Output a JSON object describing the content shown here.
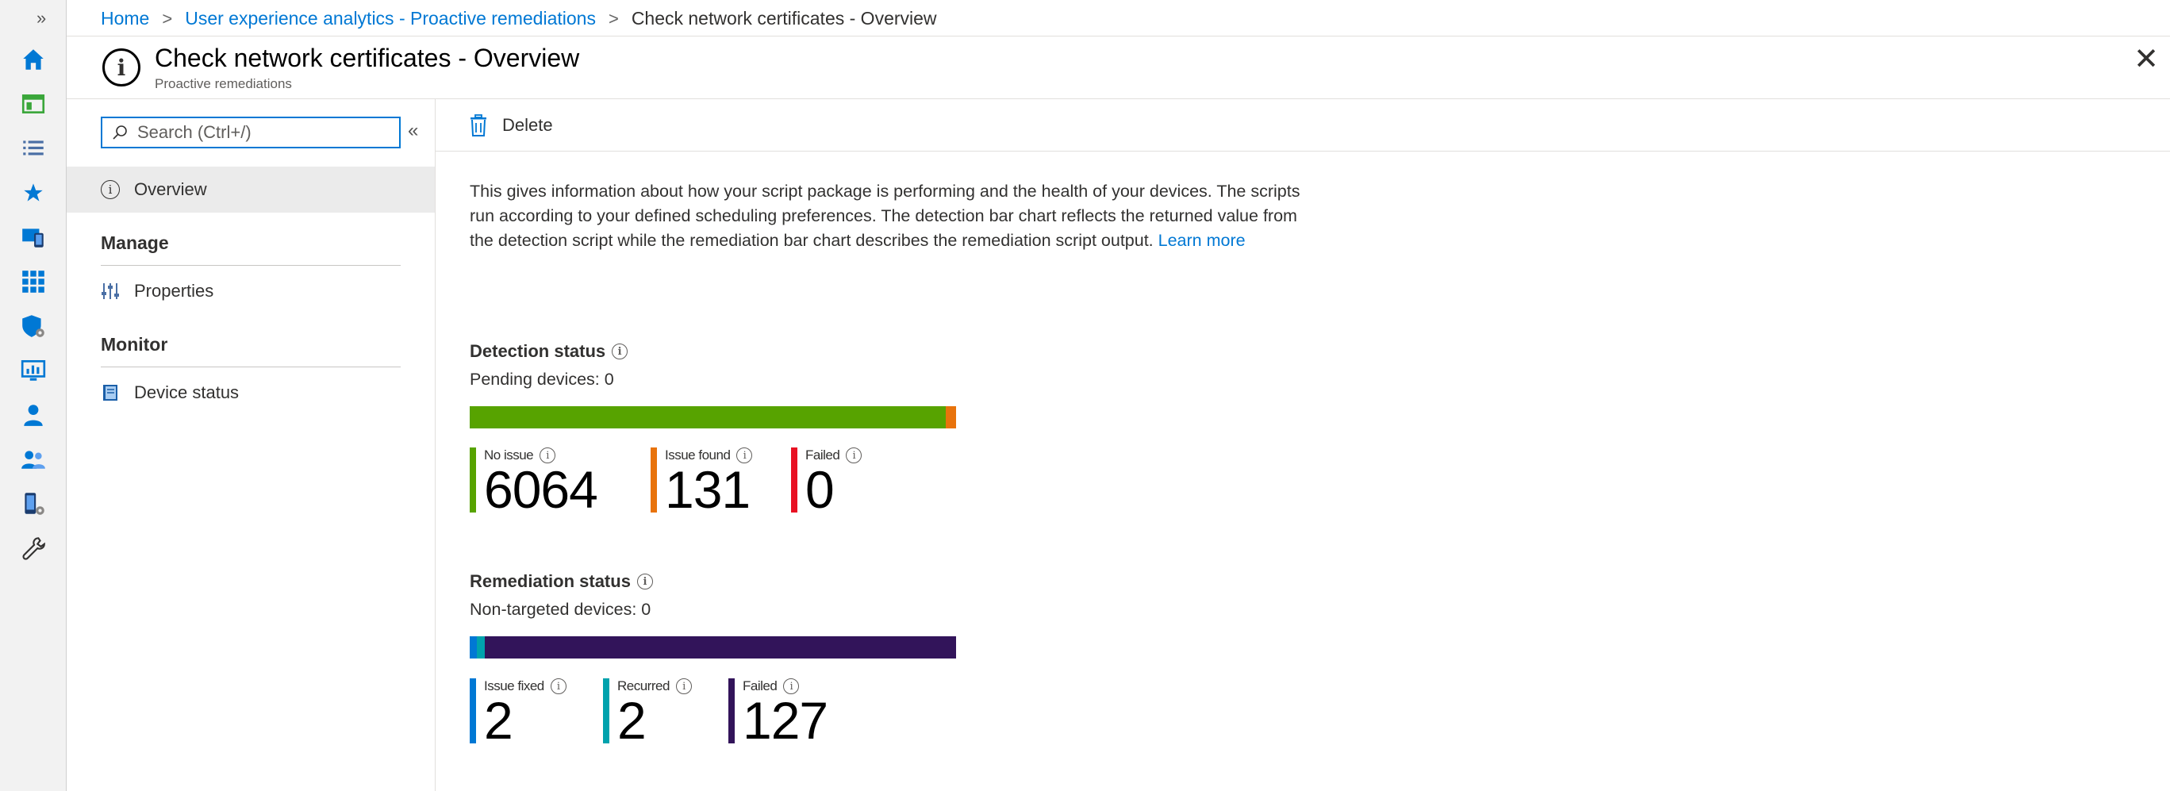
{
  "breadcrumb": {
    "home": "Home",
    "parent": "User experience analytics - Proactive remediations",
    "current": "Check network certificates - Overview"
  },
  "header": {
    "title": "Check network certificates - Overview",
    "subtitle": "Proactive remediations"
  },
  "nav": {
    "search_placeholder": "Search (Ctrl+/)",
    "overview": "Overview",
    "manage_heading": "Manage",
    "properties": "Properties",
    "monitor_heading": "Monitor",
    "device_status": "Device status"
  },
  "toolbar": {
    "delete_label": "Delete"
  },
  "description": {
    "text": "This gives information about how your script package is performing and the health of your devices. The scripts run according to your defined scheduling preferences. The detection bar chart reflects the returned value from the detection script while the remediation bar chart describes the remediation script output.",
    "learn_more": "Learn more"
  },
  "detection": {
    "title": "Detection status",
    "pending": "Pending devices: 0",
    "metrics": [
      {
        "label": "No issue",
        "value": 6064,
        "color": "#57a300"
      },
      {
        "label": "Issue found",
        "value": 131,
        "color": "#e8730c"
      },
      {
        "label": "Failed",
        "value": 0,
        "color": "#e81123"
      }
    ]
  },
  "remediation": {
    "title": "Remediation status",
    "non_targeted": "Non-targeted devices: 0",
    "metrics": [
      {
        "label": "Issue fixed",
        "value": 2,
        "color": "#0078d4"
      },
      {
        "label": "Recurred",
        "value": 2,
        "color": "#00a2ad"
      },
      {
        "label": "Failed",
        "value": 127,
        "color": "#32145a"
      }
    ]
  },
  "rail_icons": [
    "home-icon",
    "dashboard-icon",
    "all-services-icon",
    "favorites-star-icon",
    "devices-icon",
    "apps-icon",
    "endpoint-security-icon",
    "reports-icon",
    "users-icon",
    "groups-icon",
    "tenant-admin-icon",
    "troubleshooting-icon"
  ]
}
